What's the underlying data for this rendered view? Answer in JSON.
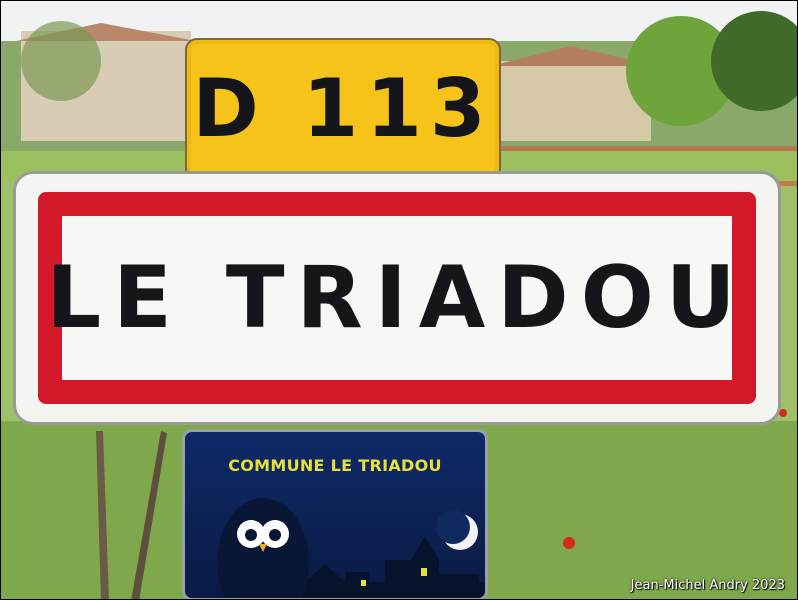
{
  "road_plate": {
    "text": "D 113",
    "color": "#f6c31a"
  },
  "town_sign": {
    "name": "LE TRIADOU",
    "border_color": "#d3182a"
  },
  "commune_panel": {
    "title": "COMMUNE LE TRIADOU",
    "title_color": "#e7e037",
    "background": "#0f2a68",
    "icons": [
      "owl-icon",
      "moon-icon",
      "village-silhouette-icon"
    ]
  },
  "credit": "Jean-Michel Andry 2023"
}
